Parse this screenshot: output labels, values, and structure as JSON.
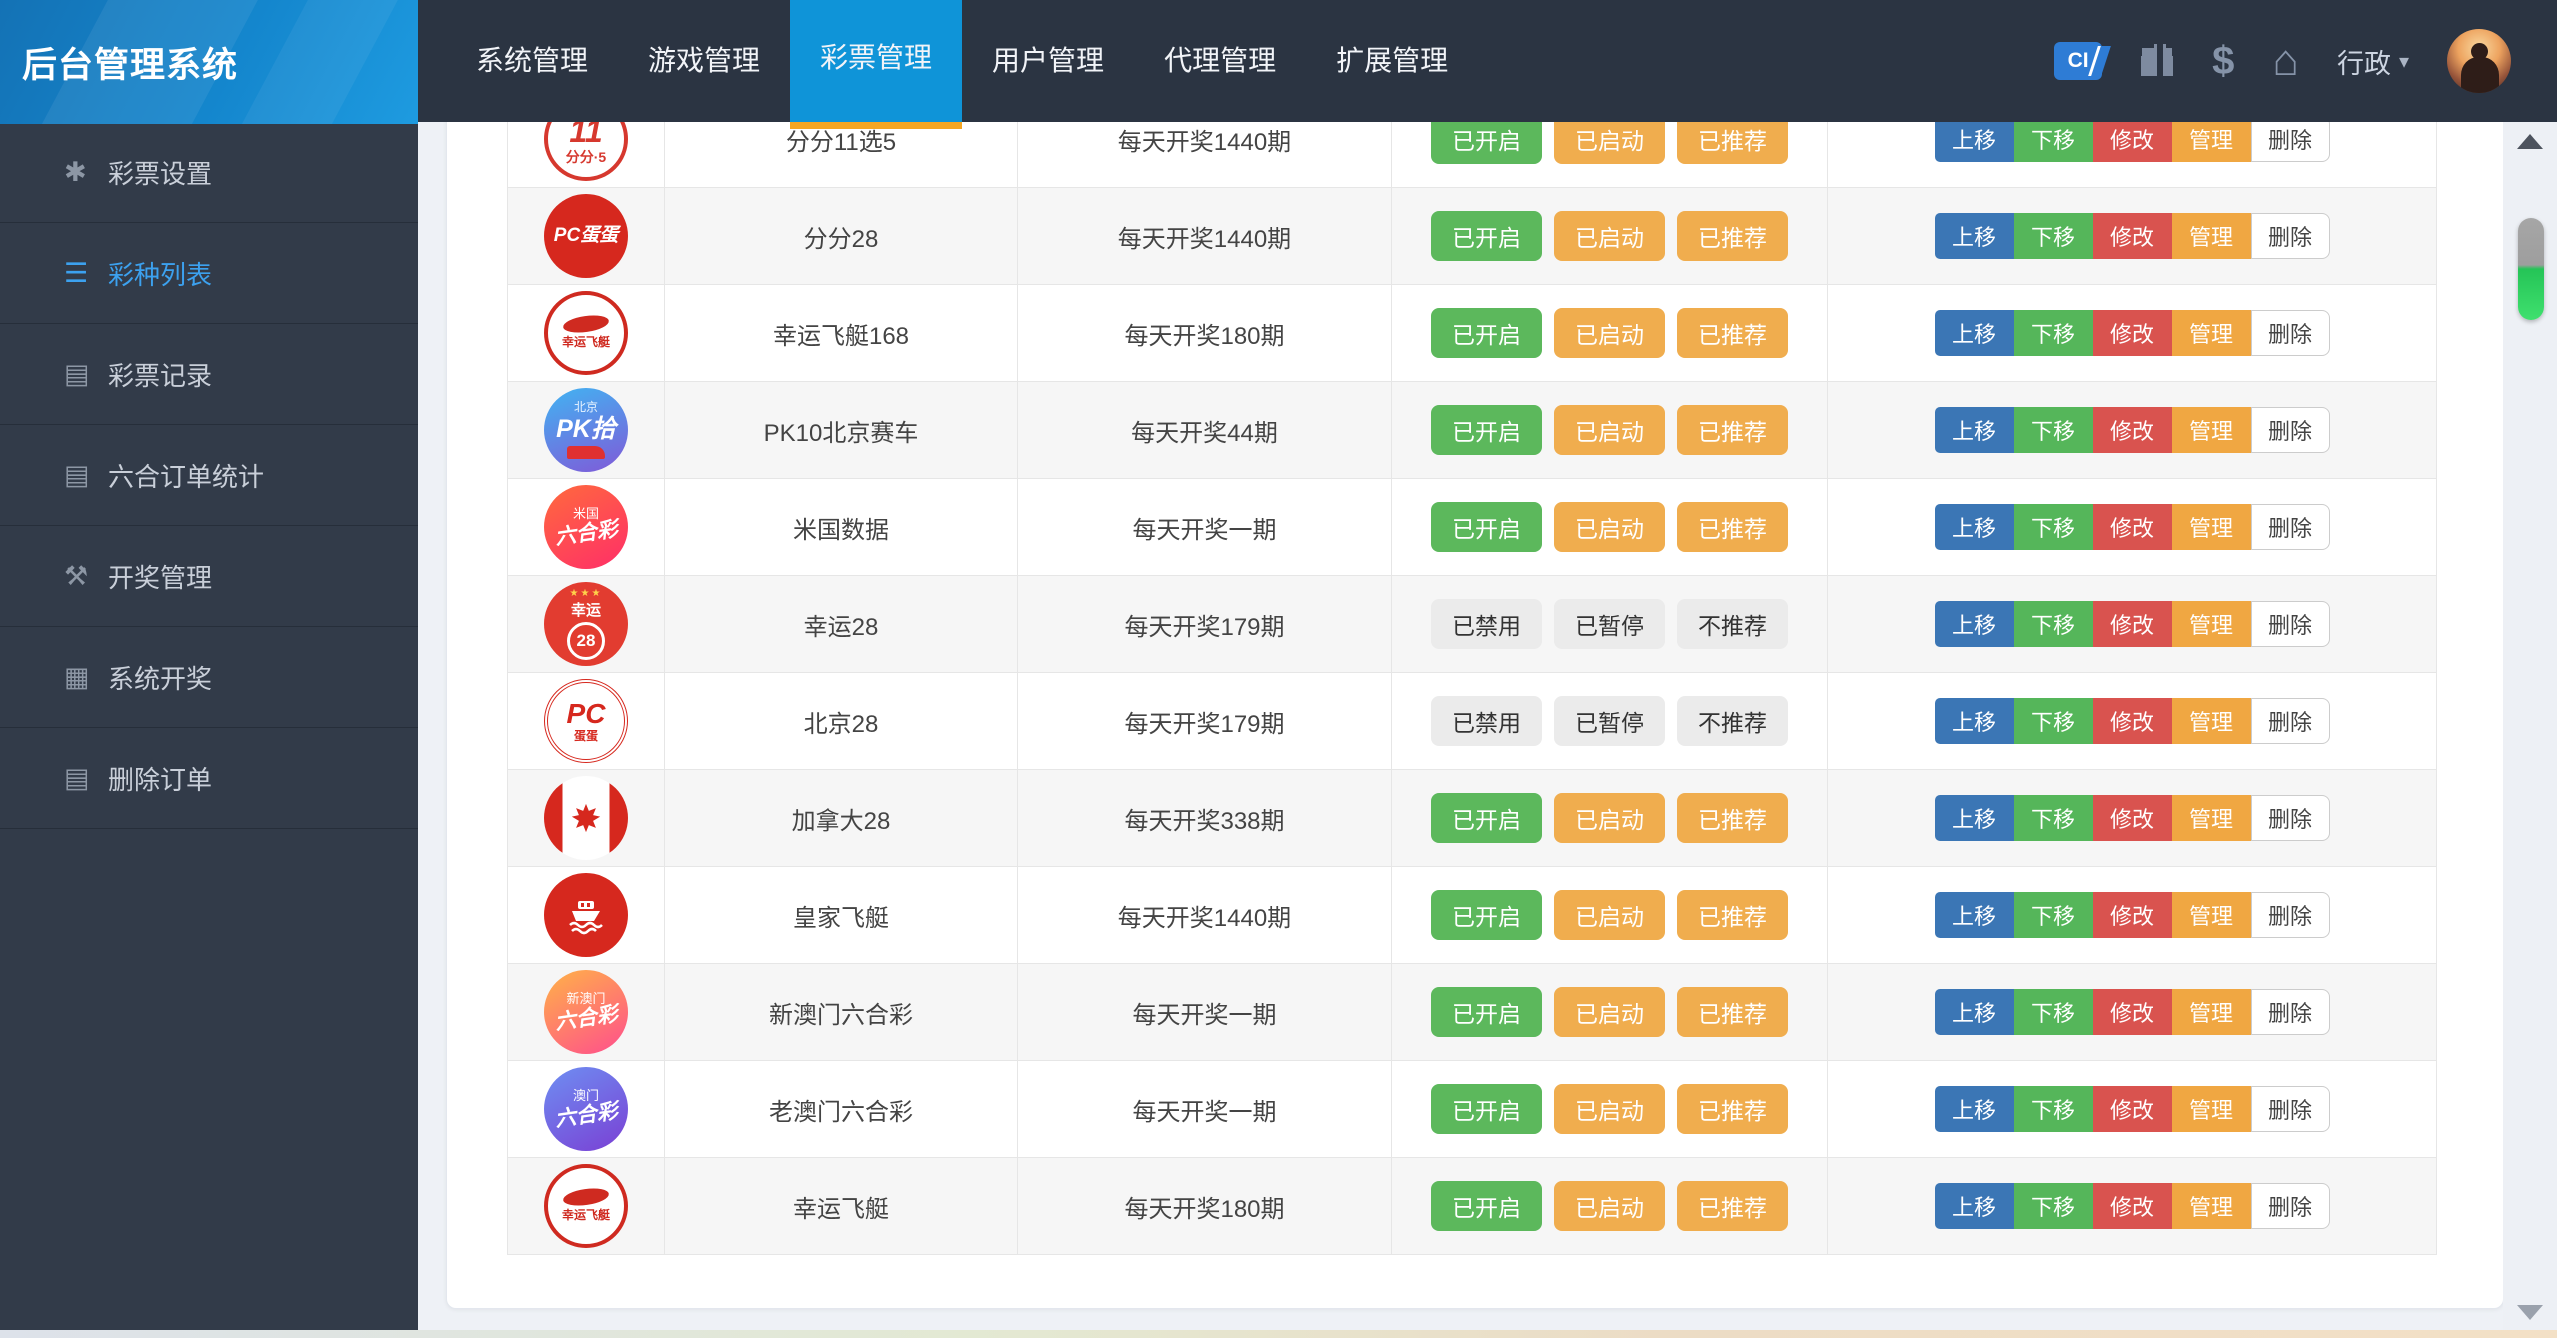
{
  "app": {
    "title": "后台管理系统"
  },
  "nav": {
    "tabs": [
      {
        "label": "系统管理",
        "active": false
      },
      {
        "label": "游戏管理",
        "active": false
      },
      {
        "label": "彩票管理",
        "active": true
      },
      {
        "label": "用户管理",
        "active": false
      },
      {
        "label": "代理管理",
        "active": false
      },
      {
        "label": "扩展管理",
        "active": false
      }
    ],
    "right": {
      "ci_badge_text": "CI",
      "dollar_glyph": "$",
      "home_glyph": "⌂",
      "org_label": "行政",
      "caret_glyph": "▾"
    }
  },
  "sidebar": {
    "items": [
      {
        "label": "彩票设置",
        "icon": "asterisk-icon",
        "glyph": "✱",
        "active": false
      },
      {
        "label": "彩种列表",
        "icon": "list-icon",
        "glyph": "☰",
        "active": true
      },
      {
        "label": "彩票记录",
        "icon": "book-icon",
        "glyph": "▤",
        "active": false
      },
      {
        "label": "六合订单统计",
        "icon": "book-icon",
        "glyph": "▤",
        "active": false
      },
      {
        "label": "开奖管理",
        "icon": "gavel-icon",
        "glyph": "⚒",
        "active": false
      },
      {
        "label": "系统开奖",
        "icon": "server-icon",
        "glyph": "▦",
        "active": false
      },
      {
        "label": "删除订单",
        "icon": "book-icon",
        "glyph": "▤",
        "active": false
      }
    ]
  },
  "table": {
    "status_on": [
      "已开启",
      "已启动",
      "已推荐"
    ],
    "status_off": [
      "已禁用",
      "已暂停",
      "不推荐"
    ],
    "status_on_variants": [
      "green",
      "orange",
      "orange"
    ],
    "status_off_variants": [
      "gray",
      "gray",
      "gray"
    ],
    "actions": [
      {
        "label": "上移",
        "variant": "blue"
      },
      {
        "label": "下移",
        "variant": "green"
      },
      {
        "label": "修改",
        "variant": "red"
      },
      {
        "label": "管理",
        "variant": "orange"
      },
      {
        "label": "删除",
        "variant": "plain"
      }
    ],
    "rows": [
      {
        "name": "分分11选5",
        "period": "每天开奖1440期",
        "enabled": true,
        "icon": {
          "kind": "ball11x5",
          "l1": "11",
          "l2": "分分·5"
        }
      },
      {
        "name": "分分28",
        "period": "每天开奖1440期",
        "enabled": true,
        "icon": {
          "kind": "pcdd",
          "l1": "PC蛋蛋",
          "l2": ""
        }
      },
      {
        "name": "幸运飞艇168",
        "period": "每天开奖180期",
        "enabled": true,
        "icon": {
          "kind": "airship",
          "l1": "",
          "l2": "幸运飞艇"
        }
      },
      {
        "name": "PK10北京赛车",
        "period": "每天开奖44期",
        "enabled": true,
        "icon": {
          "kind": "pk10",
          "l1": "北京",
          "l2": "PK拾"
        }
      },
      {
        "name": "米国数据",
        "period": "每天开奖一期",
        "enabled": true,
        "icon": {
          "kind": "liuhe-red",
          "l1": "米国",
          "l2": "六合彩"
        }
      },
      {
        "name": "幸运28",
        "period": "每天开奖179期",
        "enabled": false,
        "icon": {
          "kind": "lucky28",
          "l1": "幸运",
          "l2": "28"
        }
      },
      {
        "name": "北京28",
        "period": "每天开奖179期",
        "enabled": false,
        "icon": {
          "kind": "pc28",
          "l1": "PC",
          "l2": "蛋蛋"
        }
      },
      {
        "name": "加拿大28",
        "period": "每天开奖338期",
        "enabled": true,
        "icon": {
          "kind": "canada",
          "l1": "",
          "l2": ""
        }
      },
      {
        "name": "皇家飞艇",
        "period": "每天开奖1440期",
        "enabled": true,
        "icon": {
          "kind": "boat",
          "l1": "",
          "l2": ""
        }
      },
      {
        "name": "新澳门六合彩",
        "period": "每天开奖一期",
        "enabled": true,
        "icon": {
          "kind": "liuhe-orange",
          "l1": "新澳门",
          "l2": "六合彩"
        }
      },
      {
        "name": "老澳门六合彩",
        "period": "每天开奖一期",
        "enabled": true,
        "icon": {
          "kind": "liuhe-purple",
          "l1": "澳门",
          "l2": "六合彩"
        }
      },
      {
        "name": "幸运飞艇",
        "period": "每天开奖180期",
        "enabled": true,
        "icon": {
          "kind": "airship",
          "l1": "",
          "l2": "幸运飞艇"
        }
      }
    ]
  },
  "colors": {
    "nav_bg": "#2b3442",
    "sidebar_bg": "#323b49",
    "accent_blue": "#0f94d8",
    "tab_underline": "#f5a623",
    "green": "#5cb85c",
    "orange": "#f0ad4e",
    "move_blue": "#3b76b5",
    "red": "#d9534f",
    "page_bg": "#eef1f6",
    "scroll_green": "#3fe06e"
  }
}
